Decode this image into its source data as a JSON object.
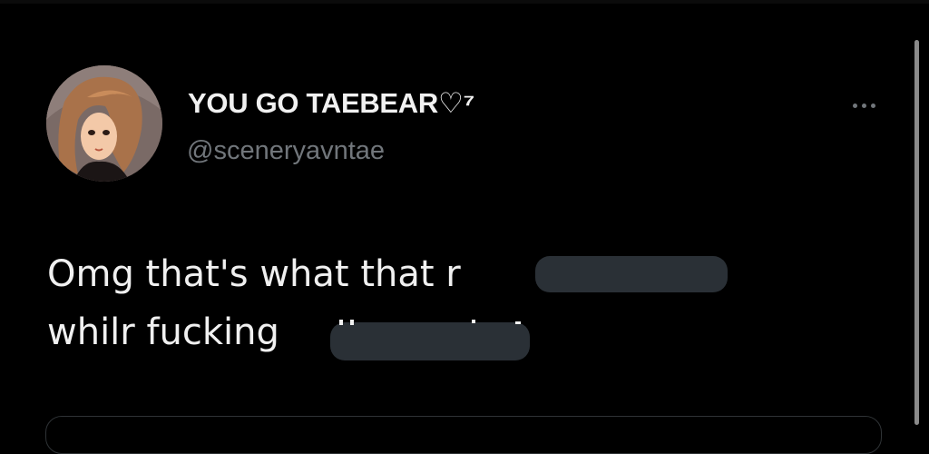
{
  "tweet": {
    "display_name": "YOU GO TAEBEAR♡⁷",
    "handle": "@sceneryavntae",
    "line1": "Omg that's what that r              aid",
    "line2": "whilr fucking"
  },
  "icons": {
    "more": "more-horizontal-icon",
    "avatar": "user-avatar"
  },
  "colors": {
    "background": "#000000",
    "primary_text": "#e7e9ea",
    "secondary_text": "#71767b",
    "redaction": "#2a3036"
  }
}
